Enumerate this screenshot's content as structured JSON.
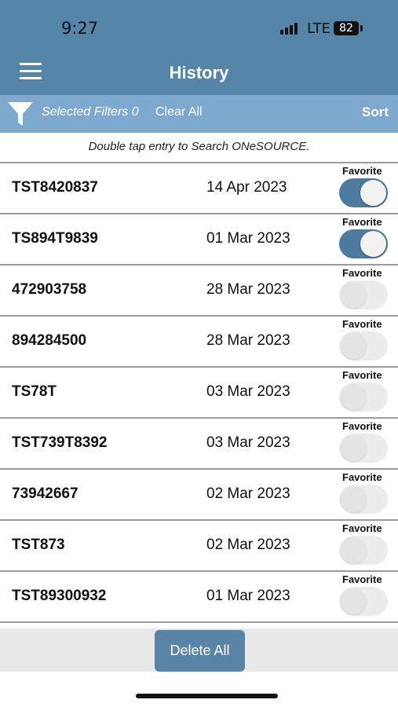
{
  "status_bar": {
    "time": "9:27",
    "network": "LTE",
    "battery": "82"
  },
  "header": {
    "title": "History",
    "menu_icon": "hamburger-menu-icon",
    "color": "#5586a8"
  },
  "filter_bar": {
    "filter_icon": "funnel-icon",
    "selected_filters": "Selected Filters 0",
    "clear_all": "Clear All",
    "sort": "Sort",
    "color": "#7ea9cf"
  },
  "hint": "Double tap entry to Search ONeSOURCE.",
  "favorite_label": "Favorite",
  "entries": [
    {
      "id": "TST8420837",
      "date": "14 Apr 2023",
      "favorite": true
    },
    {
      "id": "TS894T9839",
      "date": "01 Mar 2023",
      "favorite": true
    },
    {
      "id": "472903758",
      "date": "28 Mar 2023",
      "favorite": false
    },
    {
      "id": "894284500",
      "date": "28 Mar 2023",
      "favorite": false
    },
    {
      "id": "TS78T",
      "date": "03 Mar 2023",
      "favorite": false
    },
    {
      "id": "TST739T8392",
      "date": "03 Mar 2023",
      "favorite": false
    },
    {
      "id": "73942667",
      "date": "02 Mar 2023",
      "favorite": false
    },
    {
      "id": "TST873",
      "date": "02 Mar 2023",
      "favorite": false
    },
    {
      "id": "TST89300932",
      "date": "01 Mar 2023",
      "favorite": false
    }
  ],
  "delete_all": "Delete All",
  "accent_color": "#4f7aa0"
}
